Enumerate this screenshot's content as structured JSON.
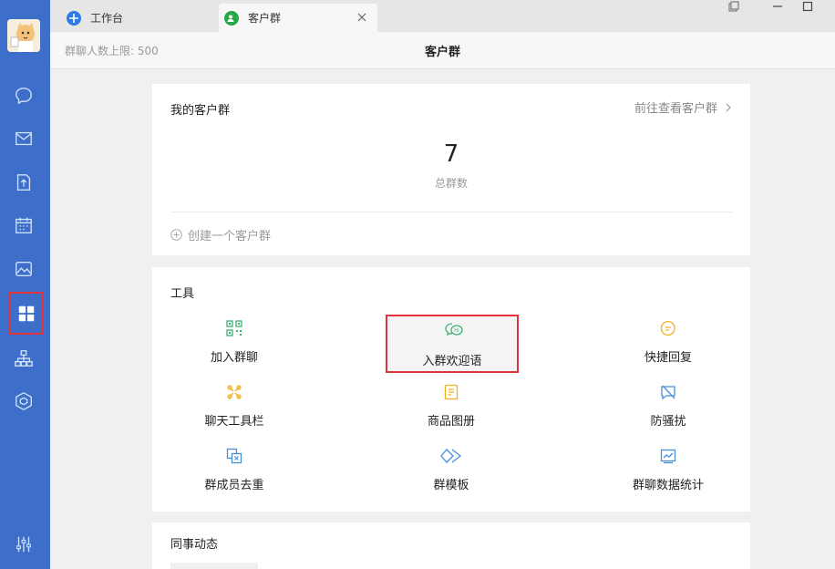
{
  "tabs": [
    {
      "label": "工作台",
      "icon": "workbench-icon",
      "active": false
    },
    {
      "label": "客户群",
      "icon": "customer-group-icon",
      "active": true
    }
  ],
  "header": {
    "limit_text": "群聊人数上限: 500",
    "title": "客户群"
  },
  "my_groups": {
    "title": "我的客户群",
    "goto_label": "前往查看客户群",
    "count": "7",
    "count_label": "总群数",
    "create_label": "创建一个客户群"
  },
  "tools": {
    "title": "工具",
    "items": [
      {
        "label": "加入群聊",
        "icon": "qrcode-icon",
        "color": "#3cb371"
      },
      {
        "label": "入群欢迎语",
        "icon": "welcome-chat-icon",
        "color": "#3cb371"
      },
      {
        "label": "快捷回复",
        "icon": "quick-reply-icon",
        "color": "#f2b01e"
      },
      {
        "label": "聊天工具栏",
        "icon": "toolbar-icon",
        "color": "#f2b01e"
      },
      {
        "label": "商品图册",
        "icon": "catalog-icon",
        "color": "#f2b01e"
      },
      {
        "label": "防骚扰",
        "icon": "anti-harass-icon",
        "color": "#4a90d9"
      },
      {
        "label": "群成员去重",
        "icon": "dedupe-icon",
        "color": "#4a90d9"
      },
      {
        "label": "群模板",
        "icon": "template-icon",
        "color": "#4a90d9"
      },
      {
        "label": "群聊数据统计",
        "icon": "stats-icon",
        "color": "#4a90d9"
      }
    ]
  },
  "colleague": {
    "title": "同事动态"
  },
  "colors": {
    "sidebar": "#3d6ec9",
    "highlight": "#e0333b",
    "green": "#3cb371",
    "yellow": "#f2b01e",
    "blue": "#4a90d9"
  }
}
